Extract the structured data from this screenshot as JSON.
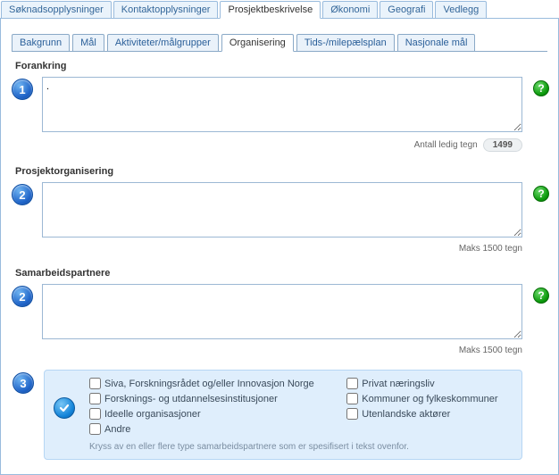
{
  "outer_tabs": {
    "items": [
      {
        "label": "Søknadsopplysninger"
      },
      {
        "label": "Kontaktopplysninger"
      },
      {
        "label": "Prosjektbeskrivelse"
      },
      {
        "label": "Økonomi"
      },
      {
        "label": "Geografi"
      },
      {
        "label": "Vedlegg"
      }
    ]
  },
  "sub_tabs": {
    "items": [
      {
        "label": "Bakgrunn"
      },
      {
        "label": "Mål"
      },
      {
        "label": "Aktiviteter/målgrupper"
      },
      {
        "label": "Organisering"
      },
      {
        "label": "Tids-/milepælsplan"
      },
      {
        "label": "Nasjonale mål"
      }
    ]
  },
  "sections": {
    "forankring": {
      "badge": "1",
      "title": "Forankring",
      "value": ".",
      "count_label": "Antall ledig tegn",
      "count_value": "1499",
      "help": "?"
    },
    "prosjektorganisering": {
      "badge": "2",
      "title": "Prosjektorganisering",
      "value": "",
      "limit_label": "Maks 1500 tegn",
      "help": "?"
    },
    "samarbeidspartnere": {
      "badge": "2",
      "title": "Samarbeidspartnere",
      "value": "",
      "limit_label": "Maks 1500 tegn",
      "help": "?"
    }
  },
  "partner_types": {
    "badge": "3",
    "options": [
      {
        "label": "Siva, Forskningsrådet og/eller Innovasjon Norge"
      },
      {
        "label": "Privat næringsliv"
      },
      {
        "label": "Forsknings- og utdannelsesinstitusjoner"
      },
      {
        "label": "Kommuner og fylkeskommuner"
      },
      {
        "label": "Ideelle organisasjoner"
      },
      {
        "label": "Utenlandske aktører"
      },
      {
        "label": "Andre"
      }
    ],
    "note": "Kryss av en eller flere type samarbeidspartnere som er spesifisert i tekst ovenfor."
  }
}
